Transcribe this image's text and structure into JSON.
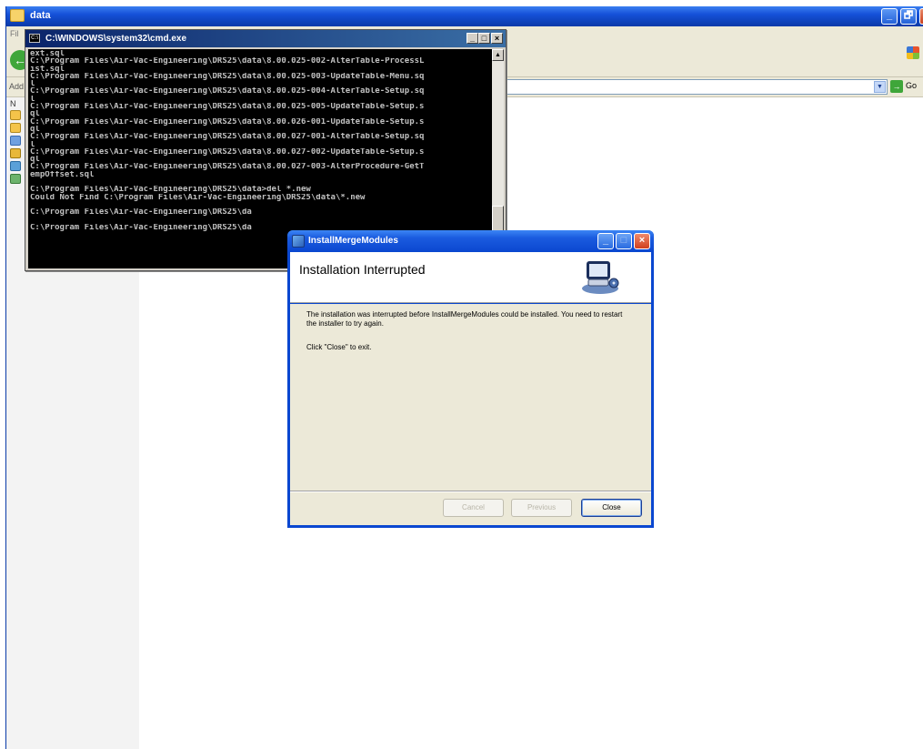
{
  "explorer": {
    "title": "data",
    "menu_first": "Fil",
    "address_label": "Add",
    "go_label": "Go",
    "taskpane_label": "N",
    "title_buttons": {
      "minimize": "_",
      "restore": "🗗"
    }
  },
  "cmd": {
    "title": "C:\\WINDOWS\\system32\\cmd.exe",
    "buttons": {
      "minimize": "_",
      "maximize": "□",
      "close": "×"
    },
    "lines": [
      "ext.sql",
      "C:\\Program Files\\Air-Vac-Engineering\\DRS25\\data\\8.00.025-002-AlterTable-ProcessL",
      "ist.sql",
      "C:\\Program Files\\Air-Vac-Engineering\\DRS25\\data\\8.00.025-003-UpdateTable-Menu.sq",
      "l",
      "C:\\Program Files\\Air-Vac-Engineering\\DRS25\\data\\8.00.025-004-AlterTable-Setup.sq",
      "l",
      "C:\\Program Files\\Air-Vac-Engineering\\DRS25\\data\\8.00.025-005-UpdateTable-Setup.s",
      "ql",
      "C:\\Program Files\\Air-Vac-Engineering\\DRS25\\data\\8.00.026-001-UpdateTable-Setup.s",
      "ql",
      "C:\\Program Files\\Air-Vac-Engineering\\DRS25\\data\\8.00.027-001-AlterTable-Setup.sq",
      "l",
      "C:\\Program Files\\Air-Vac-Engineering\\DRS25\\data\\8.00.027-002-UpdateTable-Setup.s",
      "ql",
      "C:\\Program Files\\Air-Vac-Engineering\\DRS25\\data\\8.00.027-003-AlterProcedure-GetT",
      "empOffset.sql",
      "",
      "C:\\Program Files\\Air-Vac-Engineering\\DRS25\\data>del *.new",
      "Could Not Find C:\\Program Files\\Air-Vac-Engineering\\DRS25\\data\\*.new",
      "",
      "C:\\Program Files\\Air-Vac-Engineering\\DRS25\\da",
      "",
      "C:\\Program Files\\Air-Vac-Engineering\\DRS25\\da"
    ]
  },
  "dialog": {
    "title": "InstallMergeModules",
    "heading": "Installation Interrupted",
    "message": "The installation was interrupted before InstallMergeModules could be installed. You need to restart the installer to try again.",
    "instruction": "Click \"Close\" to exit.",
    "cancel_label": "Cancel",
    "previous_label": "Previous",
    "close_label": "Close",
    "title_buttons": {
      "minimize": "_",
      "maximize": "□",
      "close": "×"
    }
  }
}
